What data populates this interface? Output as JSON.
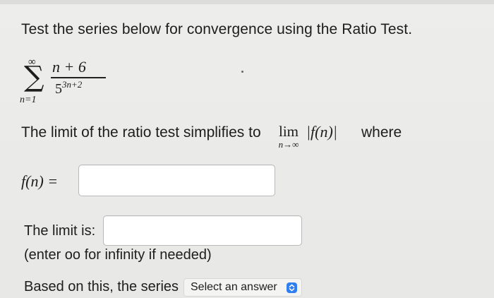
{
  "question": {
    "instruction": "Test the series below for convergence using the Ratio Test."
  },
  "series": {
    "sum_upper": "∞",
    "sum_symbol": "∑",
    "sum_lower": "n=1",
    "numerator": "n + 6",
    "denominator_base": "5",
    "denominator_exponent": "3n+2"
  },
  "limit_statement": {
    "prefix": "The limit of the ratio test simplifies to",
    "lim": "lim",
    "lim_sub": "n→∞",
    "expression": "|f(n)|",
    "suffix": "where"
  },
  "fn_field": {
    "label": "f(n) =",
    "value": ""
  },
  "limit_field": {
    "label": "The limit is:",
    "value": "",
    "hint": "(enter oo for infinity if needed)"
  },
  "conclusion": {
    "prefix": "Based on this, the series",
    "select_value": "Select an answer"
  },
  "colors": {
    "background": "#e9e9e7",
    "select_accent": "#2f7ff0"
  }
}
